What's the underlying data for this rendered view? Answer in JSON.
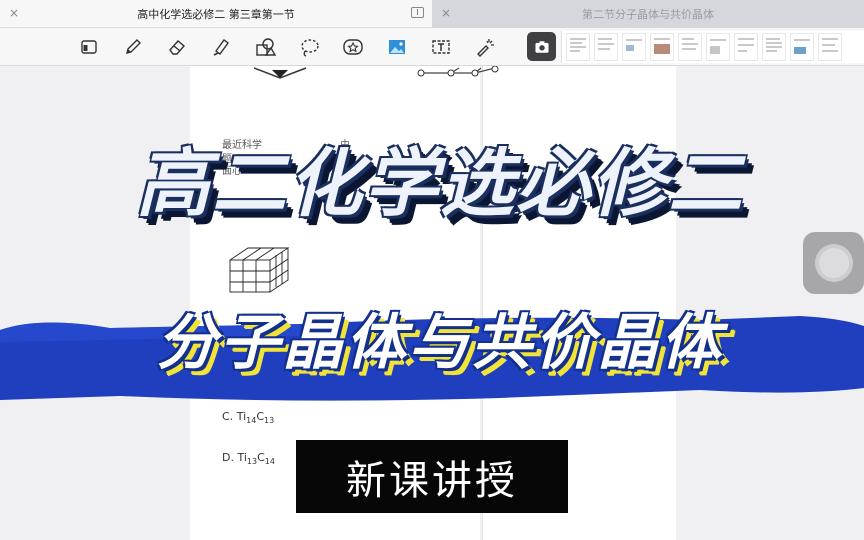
{
  "tabs": [
    {
      "title": "高中化学选必修二 第三章第一节",
      "active": true
    },
    {
      "title": "第二节分子晶体与共价晶体",
      "active": false
    }
  ],
  "toolbar": {
    "tools": [
      "page-view-icon",
      "pen-icon",
      "eraser-icon",
      "highlighter-icon",
      "shapes-icon",
      "lasso-icon",
      "sticker-icon",
      "image-icon",
      "text-box-icon",
      "laser-pointer-icon"
    ],
    "capture_tool": "camera-icon",
    "thumbnail_count": 10
  },
  "document": {
    "snippet_line1": "最近科学",
    "snippet_line1b": "由",
    "snippet_line2": "题",
    "snippet_line3": "面心",
    "option_c": {
      "letter": "C.",
      "a": "Ti",
      "a_sub": "14",
      "b": "C",
      "b_sub": "13"
    },
    "option_d": {
      "letter": "D.",
      "a": "Ti",
      "a_sub": "13",
      "b": "C",
      "b_sub": "14"
    }
  },
  "banner": {
    "title": "高二化学选必修二",
    "subtitle": "分子晶体与共价晶体",
    "lesson_label": "新课讲授"
  },
  "colors": {
    "band_blue": "#1f3fbf",
    "title_outline": "#1b2f5e",
    "subtitle_shadow": "#f1e33a",
    "lesson_bg": "#070707"
  }
}
